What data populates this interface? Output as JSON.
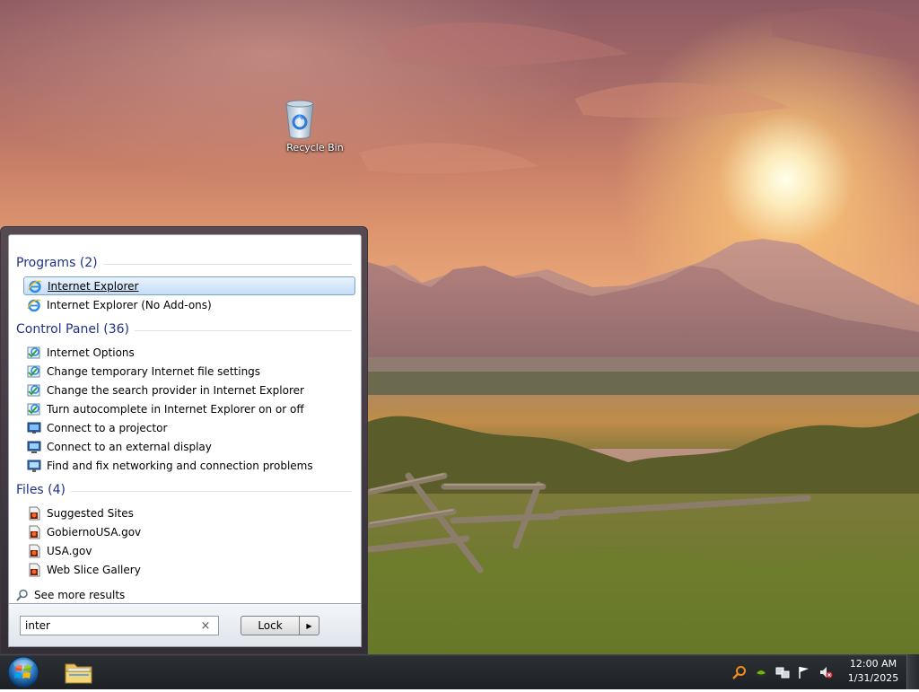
{
  "desktop": {
    "icons": [
      {
        "label": "Recycle Bin",
        "icon": "recycle-bin-icon"
      }
    ]
  },
  "start_menu": {
    "groups": [
      {
        "title": "Programs (2)",
        "items": [
          {
            "label": "Internet Explorer",
            "icon": "internet-explorer-icon",
            "selected": true
          },
          {
            "label": "Internet Explorer (No Add-ons)",
            "icon": "internet-explorer-icon"
          }
        ]
      },
      {
        "title": "Control Panel (36)",
        "items": [
          {
            "label": "Internet Options",
            "icon": "internet-options-icon"
          },
          {
            "label": "Change temporary Internet file settings",
            "icon": "internet-options-icon"
          },
          {
            "label": "Change the search provider in Internet Explorer",
            "icon": "internet-options-icon"
          },
          {
            "label": "Turn autocomplete in Internet Explorer on or off",
            "icon": "internet-options-icon"
          },
          {
            "label": "Connect to a projector",
            "icon": "projector-icon"
          },
          {
            "label": "Connect to an external display",
            "icon": "display-icon"
          },
          {
            "label": "Find and fix networking and connection problems",
            "icon": "network-troubleshoot-icon"
          }
        ]
      },
      {
        "title": "Files (4)",
        "items": [
          {
            "label": "Suggested Sites",
            "icon": "web-slice-icon"
          },
          {
            "label": "GobiernoUSA.gov",
            "icon": "web-slice-icon"
          },
          {
            "label": "USA.gov",
            "icon": "web-slice-icon"
          },
          {
            "label": "Web Slice Gallery",
            "icon": "web-slice-icon"
          }
        ]
      }
    ],
    "see_more": "See more results",
    "search": {
      "value": "inter",
      "clear_icon": "×"
    },
    "lock_button": "Lock",
    "lock_arrow_icon": "▶"
  },
  "taskbar": {
    "pinned": [
      "windows-explorer-icon"
    ],
    "tray_icons": [
      "search-icon",
      "nvidia-icon",
      "network-icon",
      "action-center-flag-icon",
      "volume-muted-icon"
    ],
    "clock": {
      "time": "12:00 AM",
      "date": "1/31/2025"
    }
  },
  "colors": {
    "group_title": "#1e3287",
    "selection_border": "#7da2ce",
    "taskbar": "#1d2125"
  }
}
